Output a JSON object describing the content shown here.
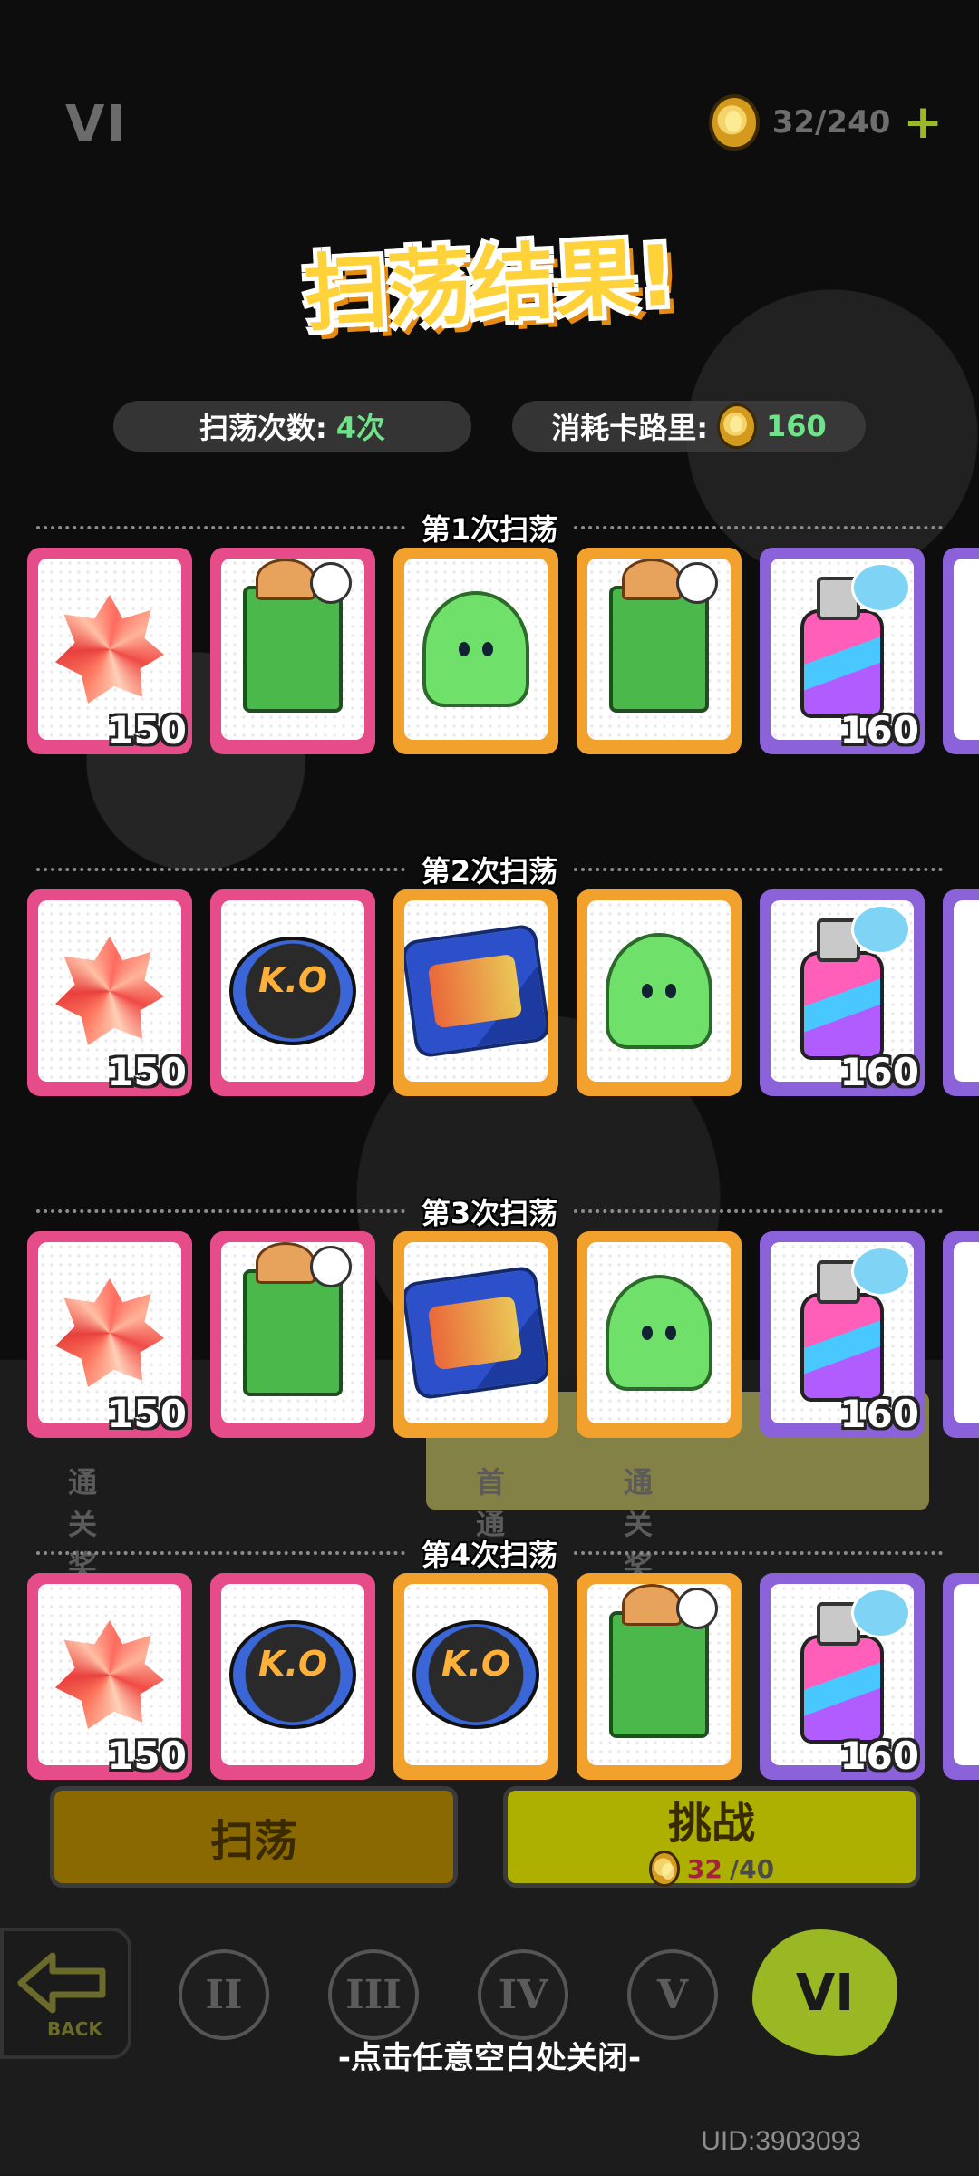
{
  "header": {
    "stage": "VI",
    "energy": "32/240",
    "plus": "+"
  },
  "title": "扫荡结果!",
  "stats": {
    "count_label": "扫荡次数:",
    "count_value": "4次",
    "cost_label": "消耗卡路里:",
    "cost_value": "160"
  },
  "rounds": [
    {
      "title": "第1次扫荡",
      "items": [
        {
          "icon": "gem-icon",
          "rarity": "pink",
          "count": "150"
        },
        {
          "icon": "trash-box-icon",
          "rarity": "pink",
          "count": ""
        },
        {
          "icon": "trash-bag-icon",
          "rarity": "orange",
          "count": ""
        },
        {
          "icon": "trash-box-icon",
          "rarity": "orange",
          "count": ""
        },
        {
          "icon": "spray-icon",
          "rarity": "purple",
          "count": "160"
        }
      ]
    },
    {
      "title": "第2次扫荡",
      "items": [
        {
          "icon": "gem-icon",
          "rarity": "pink",
          "count": "150"
        },
        {
          "icon": "badge-ko-icon",
          "rarity": "pink",
          "count": ""
        },
        {
          "icon": "badge-skill-icon",
          "rarity": "orange",
          "count": ""
        },
        {
          "icon": "trash-bag-icon",
          "rarity": "orange",
          "count": ""
        },
        {
          "icon": "spray-icon",
          "rarity": "purple",
          "count": "160"
        }
      ]
    },
    {
      "title": "第3次扫荡",
      "items": [
        {
          "icon": "gem-icon",
          "rarity": "pink",
          "count": "150"
        },
        {
          "icon": "trash-box-icon",
          "rarity": "pink",
          "count": ""
        },
        {
          "icon": "badge-skill-icon",
          "rarity": "orange",
          "count": ""
        },
        {
          "icon": "trash-bag-icon",
          "rarity": "orange",
          "count": ""
        },
        {
          "icon": "spray-icon",
          "rarity": "purple",
          "count": "160"
        }
      ]
    },
    {
      "title": "第4次扫荡",
      "items": [
        {
          "icon": "gem-icon",
          "rarity": "pink",
          "count": "150"
        },
        {
          "icon": "badge-ko-icon",
          "rarity": "pink",
          "count": ""
        },
        {
          "icon": "badge-ko-icon",
          "rarity": "orange",
          "count": ""
        },
        {
          "icon": "trash-box-icon",
          "rarity": "orange",
          "count": ""
        },
        {
          "icon": "spray-icon",
          "rarity": "purple",
          "count": "160"
        }
      ]
    }
  ],
  "background": {
    "clear_reward_left": "通关奖励",
    "first_clear": "首通",
    "clear_reward_right": "通关奖励"
  },
  "buttons": {
    "sweep": "扫荡",
    "challenge": "挑战",
    "challenge_cost_current": "32",
    "challenge_cost_total": "/40"
  },
  "stage_nav": {
    "back": "BACK",
    "stages": [
      "II",
      "III",
      "IV",
      "V"
    ],
    "active": "VI"
  },
  "close_hint": "-点击任意空白处关闭-",
  "uid": "UID:3903093",
  "colors": {
    "pink": "#e64b8a",
    "orange": "#f2a22c",
    "purple": "#8b62d9",
    "title": "#ffd23a",
    "stat_value": "#6fe38a"
  }
}
